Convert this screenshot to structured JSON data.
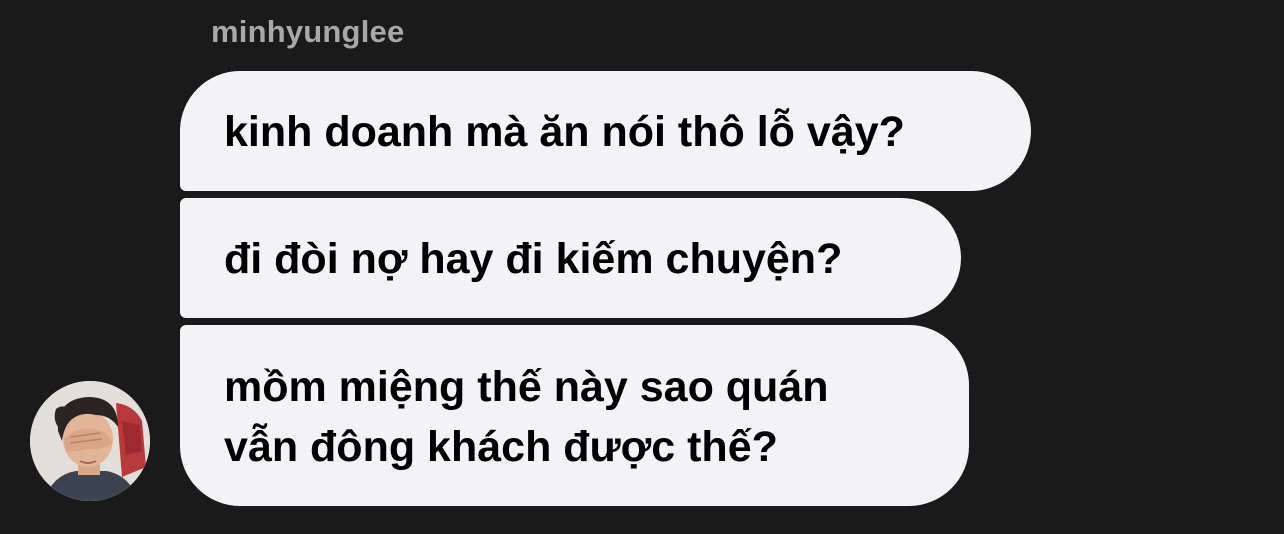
{
  "chat": {
    "sender_name": "minhyunglee",
    "messages": [
      {
        "text": "kinh doanh mà ăn nói thô lỗ vậy?"
      },
      {
        "text": "đi đòi nợ hay đi kiếm chuyện?"
      },
      {
        "line1": "mồm miệng thế này sao quán",
        "line2": "vẫn đông khách được thế?"
      }
    ],
    "avatar": {
      "icon": "user-avatar-photo"
    }
  },
  "colors": {
    "background": "#1a1a1a",
    "bubble": "#f2f2f7",
    "sender_text": "#a8a8a8",
    "message_text": "#000000"
  }
}
